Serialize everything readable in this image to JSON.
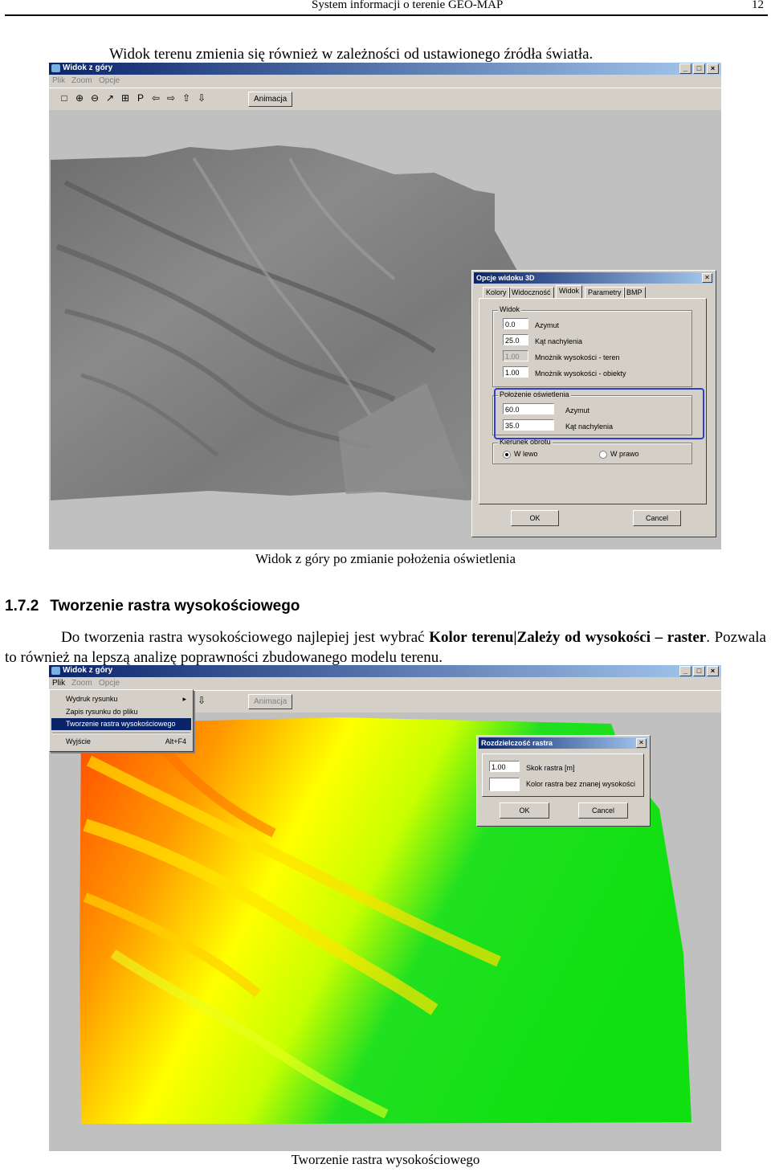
{
  "header": {
    "title": "System informacji o terenie GEO-MAP",
    "page": "12"
  },
  "intro": "Widok terenu zmienia się również w zależności od ustawionego źródła światła.",
  "window1": {
    "title": "Widok z góry",
    "menu": [
      "Plik",
      "Zoom",
      "Opcje"
    ],
    "toolbar_icons": [
      "select-icon",
      "zoom-in-icon",
      "zoom-out-icon",
      "zoom-window-icon",
      "zoom-all-icon",
      "p-icon",
      "pan-left-icon",
      "pan-right-icon",
      "pan-up-icon",
      "pan-down-icon"
    ],
    "toolbar_p": "P",
    "animation_button": "Animacja",
    "win_buttons": [
      "_",
      "□",
      "×"
    ]
  },
  "dialog1": {
    "title": "Opcje widoku 3D",
    "tabs": [
      "Kolory",
      "Widoczność",
      "Widok",
      "Parametry",
      "BMP"
    ],
    "group_view": "Widok",
    "view_fields": [
      {
        "value": "0.0",
        "label": "Azymut",
        "disabled": false
      },
      {
        "value": "25.0",
        "label": "Kąt nachylenia",
        "disabled": false
      },
      {
        "value": "1.00",
        "label": "Mnożnik wysokości - teren",
        "disabled": true
      },
      {
        "value": "1.00",
        "label": "Mnożnik wysokości - obiekty",
        "disabled": false
      }
    ],
    "group_light": "Położenie oświetlenia",
    "light_fields": [
      {
        "value": "60.0",
        "label": "Azymut"
      },
      {
        "value": "35.0",
        "label": "Kąt nachylenia"
      }
    ],
    "group_rotation": "Kierunek obrotu",
    "rotation_left": "W lewo",
    "rotation_right": "W prawo",
    "ok": "OK",
    "cancel": "Cancel",
    "highlight_color": "#2d3fd0"
  },
  "caption1": "Widok z góry po zmianie położenia oświetlenia",
  "section": {
    "number": "1.7.2",
    "title": "Tworzenie rastra wysokościowego"
  },
  "paragraph": {
    "pre": "Do tworzenia rastra wysokościowego najlepiej jest wybrać ",
    "bold": "Kolor terenu|Zależy od wysokości – raster",
    "post": ". Pozwala to również na lepszą analizę poprawności zbudowanego modelu terenu."
  },
  "window2": {
    "title": "Widok z góry",
    "menu": [
      "Plik",
      "Zoom",
      "Opcje"
    ],
    "animation_button": "Animacja"
  },
  "file_menu": {
    "items": [
      {
        "label": "Wydruk rysunku",
        "accel": "▸",
        "selected": false
      },
      {
        "label": "Zapis rysunku do pliku",
        "accel": "",
        "selected": false
      },
      {
        "label": "Tworzenie rastra wysokościowego",
        "accel": "",
        "selected": true
      },
      {
        "label": "Wyjście",
        "accel": "Alt+F4",
        "selected": false
      }
    ]
  },
  "dialog2": {
    "title": "Rozdzielczość rastra",
    "step_value": "1.00",
    "step_label": "Skok rastra [m]",
    "color_label": "Kolor rastra bez znanej wysokości",
    "ok": "OK",
    "cancel": "Cancel"
  },
  "caption2": "Tworzenie rastra wysokościowego",
  "colors": {
    "title_dark": "#0a246a",
    "title_light": "#a6caf0",
    "raster_high": "#ff4a00",
    "raster_mid": "#ffff00",
    "raster_low": "#10e010"
  }
}
